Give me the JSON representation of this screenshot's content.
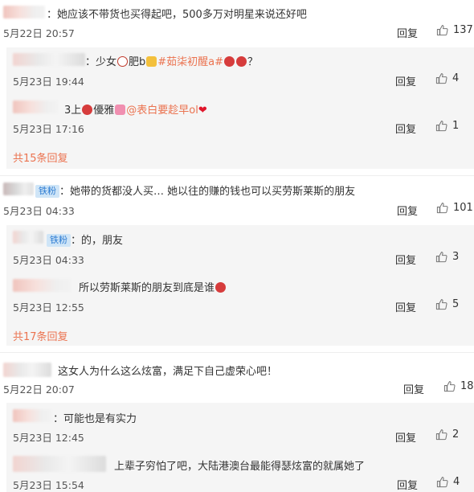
{
  "reply_label": "回复",
  "comments": [
    {
      "text": "：她应该不带货也买得起吧，500多万对明星来说还好吧",
      "time": "5月22日 20:57",
      "likes": "137",
      "replies": [
        {
          "text_prefix": "：少女",
          "text_mid1": "肥b",
          "topic": "#茹柒初醒a#",
          "text_suffix": "？",
          "time": "5月23日 19:44",
          "likes": "4"
        },
        {
          "text_prefix": "3上",
          "text_mid1": "優雅",
          "mention": "@表白要趁早ol",
          "time": "5月23日 17:16",
          "likes": "1"
        }
      ],
      "more_replies": "共15条回复"
    },
    {
      "badge": "铁粉",
      "text": "：她带的货都没人买… 她以往的赚的钱也可以买劳斯莱斯的朋友",
      "time": "5月23日 04:33",
      "likes": "101",
      "replies": [
        {
          "badge": "铁粉",
          "text": "：的，朋友",
          "time": "5月23日 04:33",
          "likes": "3"
        },
        {
          "text": "所以劳斯莱斯的朋友到底是谁",
          "time": "5月23日 12:55",
          "likes": "5"
        }
      ],
      "more_replies": "共17条回复"
    },
    {
      "text": "这女人为什么这么炫富，满足下自己虚荣心吧！",
      "time": "5月22日 20:07",
      "likes": "18",
      "replies": [
        {
          "text": "：可能也是有实力",
          "time": "5月23日 12:45",
          "likes": "2"
        },
        {
          "text": "上辈子穷怕了吧，大陆港澳台最能得瑟炫富的就属她了",
          "time": "5月23日 15:54",
          "likes": "4"
        }
      ]
    }
  ],
  "colors": {
    "accent": "#eb7350",
    "badge_bg": "#cfe5f7",
    "badge_text": "#2c7bd2",
    "sub_bg": "#f5f5f5"
  }
}
